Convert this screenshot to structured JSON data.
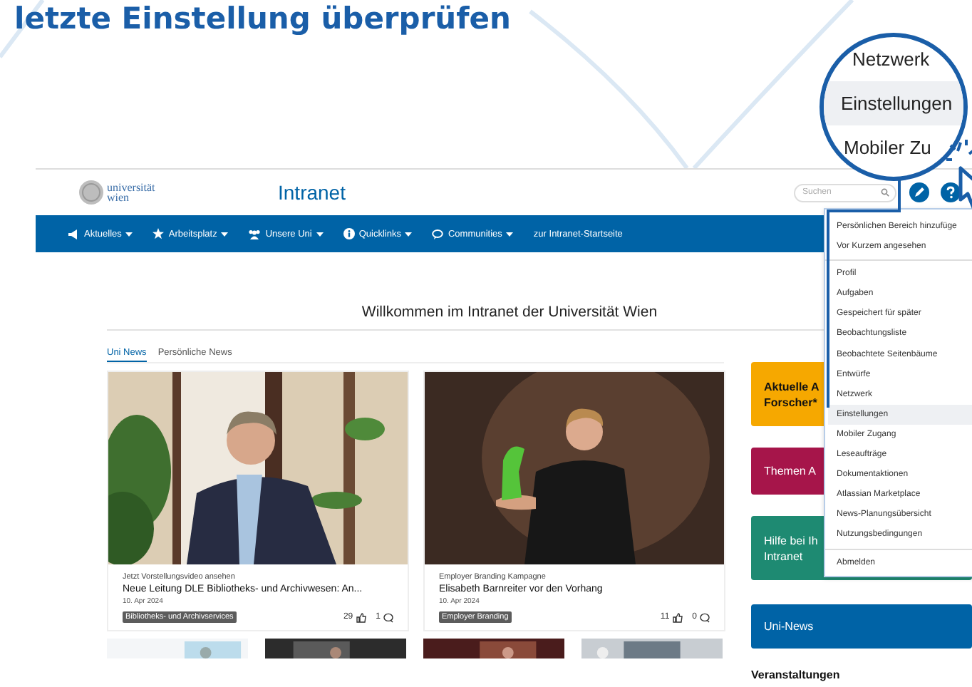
{
  "heading": "letzte Einstellung überprüfen",
  "magnifier": {
    "items": [
      {
        "label": "Netzwerk",
        "selected": false
      },
      {
        "label": "Einstellungen",
        "selected": true
      },
      {
        "label": "Mobiler Zu",
        "selected": false
      }
    ]
  },
  "header": {
    "logo_lines": [
      "universität",
      "wien"
    ],
    "title": "Intranet",
    "search": {
      "placeholder": "Suchen"
    }
  },
  "nav": [
    {
      "label": "Aktuelles",
      "dropdown": true
    },
    {
      "label": "Arbeitsplatz",
      "dropdown": true
    },
    {
      "label": "Unsere Uni",
      "dropdown": true
    },
    {
      "label": "Quicklinks",
      "dropdown": true
    },
    {
      "label": "Communities",
      "dropdown": true
    },
    {
      "label": "zur Intranet-Startseite",
      "dropdown": false
    }
  ],
  "welcome": "Willkommen im Intranet der Universität Wien",
  "tabs": [
    {
      "label": "Uni News",
      "selected": true
    },
    {
      "label": "Persönliche News",
      "selected": false
    }
  ],
  "cards": [
    {
      "kicker": "Jetzt Vorstellungsvideo ansehen",
      "title": "Neue Leitung DLE Bibliotheks- und Archivwesen: An...",
      "date": "10. Apr 2024",
      "tag": "Bibliotheks- und Archivservices",
      "likes": "29",
      "comments": "1"
    },
    {
      "kicker": "Employer Branding Kampagne",
      "title": "Elisabeth Barnreiter vor den Vorhang",
      "date": "10. Apr 2024",
      "tag": "Employer Branding",
      "likes": "11",
      "comments": "0"
    }
  ],
  "tiles": [
    {
      "lines": [
        "Aktuelle A",
        "Forscher*"
      ],
      "color": "#f6a800",
      "kind": "dark"
    },
    {
      "lines": [
        "Themen A"
      ],
      "color": "#a6154a",
      "kind": "light"
    },
    {
      "lines": [
        "Hilfe bei Ih",
        "Intranet"
      ],
      "color": "#1e8a72",
      "kind": "light"
    },
    {
      "lines": [
        "Uni-News"
      ],
      "color": "#0063a6",
      "kind": "light"
    }
  ],
  "events_heading": "Veranstaltungen",
  "menu": {
    "sections": [
      [
        {
          "label": "Persönlichen Bereich hinzufüge",
          "selected": false
        },
        {
          "label": "Vor Kurzem angesehen",
          "selected": false
        }
      ],
      [
        {
          "label": "Profil",
          "selected": false
        },
        {
          "label": "Aufgaben",
          "selected": false
        },
        {
          "label": "Gespeichert für später",
          "selected": false
        },
        {
          "label": "Beobachtungsliste",
          "selected": false
        },
        {
          "label": "Beobachtete Seitenbäume",
          "selected": false
        },
        {
          "label": "Entwürfe",
          "selected": false
        },
        {
          "label": "Netzwerk",
          "selected": false
        },
        {
          "label": "Einstellungen",
          "selected": true
        },
        {
          "label": "Mobiler Zugang",
          "selected": false
        },
        {
          "label": "Leseaufträge",
          "selected": false
        },
        {
          "label": "Dokumentaktionen",
          "selected": false
        },
        {
          "label": "Atlassian Marketplace",
          "selected": false
        },
        {
          "label": "News-Planungsübersicht",
          "selected": false
        },
        {
          "label": "Nutzungsbedingungen",
          "selected": false
        }
      ],
      [
        {
          "label": "Abmelden",
          "selected": false
        }
      ]
    ]
  }
}
